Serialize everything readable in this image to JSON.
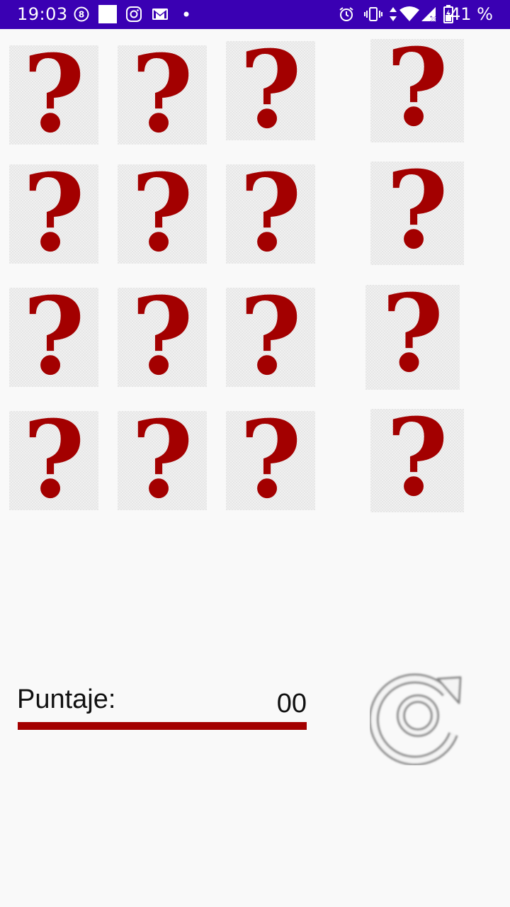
{
  "status_bar": {
    "time": "19:03",
    "battery_percent": "41 %",
    "background": "#3a00b3",
    "left_icons": [
      "notification-8-icon",
      "white-square-icon",
      "instagram-icon",
      "gmail-icon",
      "dot-icon"
    ],
    "right_icons": [
      "alarm-icon",
      "vibrate-icon",
      "data-arrows-icon",
      "wifi-icon",
      "signal-icon",
      "battery-icon"
    ]
  },
  "game": {
    "card_symbol": "?",
    "card_color": "#a30000",
    "rows": 4,
    "columns": 4
  },
  "score": {
    "label": "Puntaje:",
    "value": "00",
    "bar_color": "#a30000"
  },
  "restart": {
    "icon": "restart-icon"
  }
}
